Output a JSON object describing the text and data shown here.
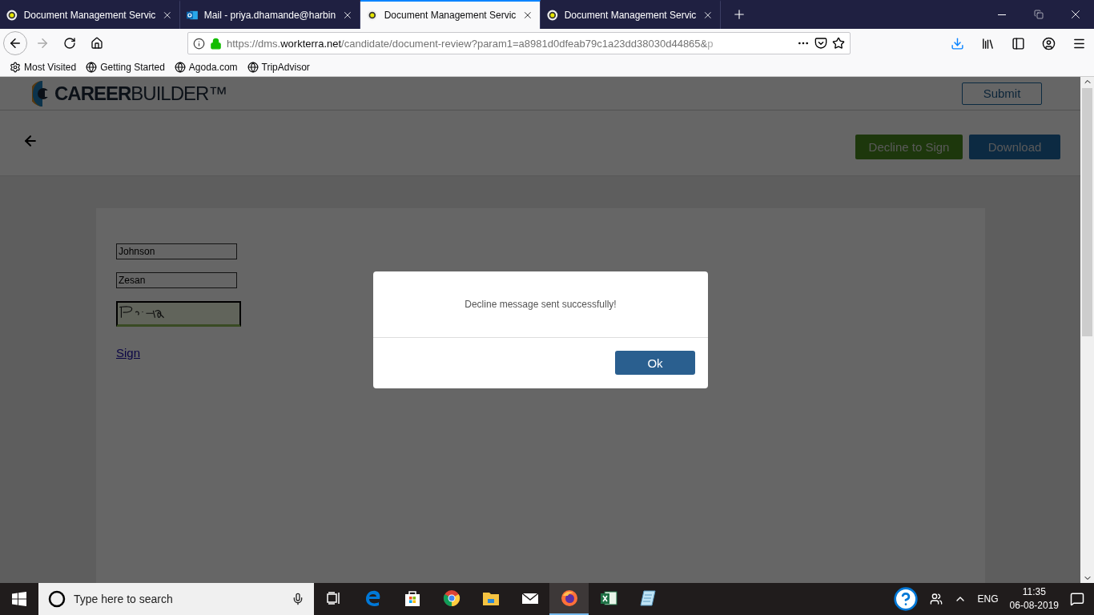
{
  "browser": {
    "tabs": [
      {
        "kind": "dms",
        "title": "Document Management Servic",
        "selected": false
      },
      {
        "kind": "mail",
        "title": "Mail - priya.dhamande@harbin",
        "selected": false
      },
      {
        "kind": "dms",
        "title": "Document Management Servic",
        "selected": true
      },
      {
        "kind": "dms",
        "title": "Document Management Servic",
        "selected": false
      }
    ],
    "address": {
      "scheme": "https://dms.",
      "host": "workterra.net",
      "path": "/candidate/document-review?param1=a8981d0dfeab79c1a23dd38030d44865&",
      "faded": "p"
    },
    "bookmarks": [
      {
        "kind": "gear",
        "label": "Most Visited"
      },
      {
        "kind": "globe",
        "label": "Getting Started"
      },
      {
        "kind": "globe",
        "label": "Agoda.com"
      },
      {
        "kind": "globe",
        "label": "TripAdvisor"
      }
    ]
  },
  "page": {
    "logo": "**CAREER**BUILDER™",
    "submit": "Submit",
    "decline": "Decline to Sign",
    "download": "Download",
    "fields": [
      {
        "value": "Johnson"
      },
      {
        "value": "Zesan"
      }
    ],
    "sign_link": "Sign"
  },
  "dialog": {
    "message": "Decline message sent successfully!",
    "ok": "Ok"
  },
  "taskbar": {
    "search_placeholder": "Type here to search",
    "apps": [
      {
        "kind": "taskview",
        "selected": false
      },
      {
        "kind": "edge",
        "selected": false
      },
      {
        "kind": "store",
        "selected": false
      },
      {
        "kind": "chrome",
        "selected": false
      },
      {
        "kind": "explorer",
        "selected": false
      },
      {
        "kind": "mail",
        "selected": false
      },
      {
        "kind": "firefox",
        "selected": true
      },
      {
        "kind": "excel",
        "selected": false
      },
      {
        "kind": "notepad",
        "selected": false
      }
    ],
    "language": "ENG",
    "time": "11:35",
    "date": "06-08-2019"
  }
}
